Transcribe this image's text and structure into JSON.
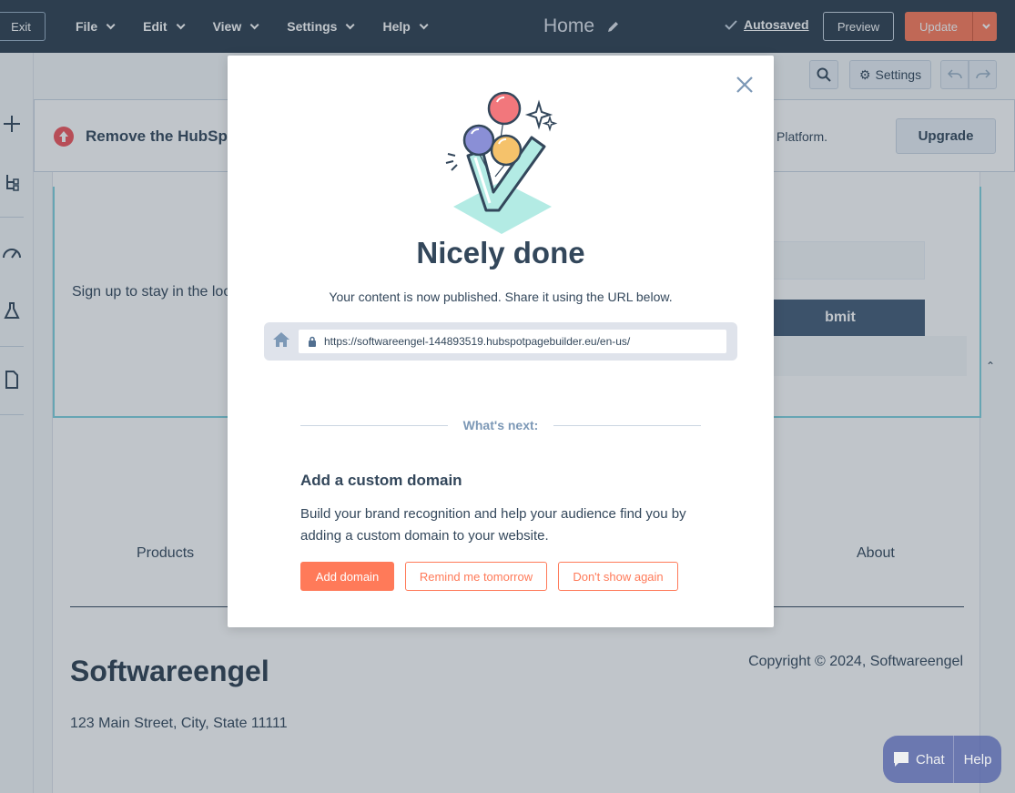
{
  "topbar": {
    "exit_label": "Exit",
    "menu": [
      {
        "label": "File"
      },
      {
        "label": "Edit"
      },
      {
        "label": "View"
      },
      {
        "label": "Settings"
      },
      {
        "label": "Help"
      }
    ],
    "page_title": "Home",
    "autosaved_label": "Autosaved",
    "preview_label": "Preview",
    "update_label": "Update"
  },
  "subbar": {
    "settings_label": "Settings"
  },
  "banner": {
    "title": "Remove the HubSp",
    "text": "Platform.",
    "upgrade_label": "Upgrade"
  },
  "canvas": {
    "signup_text": "Sign up to stay in the loop",
    "submit_label": "bmit",
    "nav": [
      "Products",
      "About"
    ],
    "brand": "Softwareengel",
    "copyright": "Copyright © 2024, Softwareengel",
    "address": "123 Main Street, City, State 11111"
  },
  "modal": {
    "title": "Nicely done",
    "subtitle": "Your content is now published. Share it using the URL below.",
    "url": "https://softwareengel-144893519.hubspotpagebuilder.eu/en-us/",
    "next_label": "What's next:",
    "domain_title": "Add a custom domain",
    "domain_text": "Build your brand recognition and help your audience find you by adding a custom domain to your website.",
    "buttons": {
      "add_domain": "Add domain",
      "remind": "Remind me tomorrow",
      "dont_show": "Don't show again"
    }
  },
  "chat": {
    "chat_label": "Chat",
    "help_label": "Help"
  },
  "colors": {
    "topbar": "#2d3e50",
    "accent": "#ff7a59",
    "text": "#33475b",
    "muted": "#7c98b6"
  }
}
